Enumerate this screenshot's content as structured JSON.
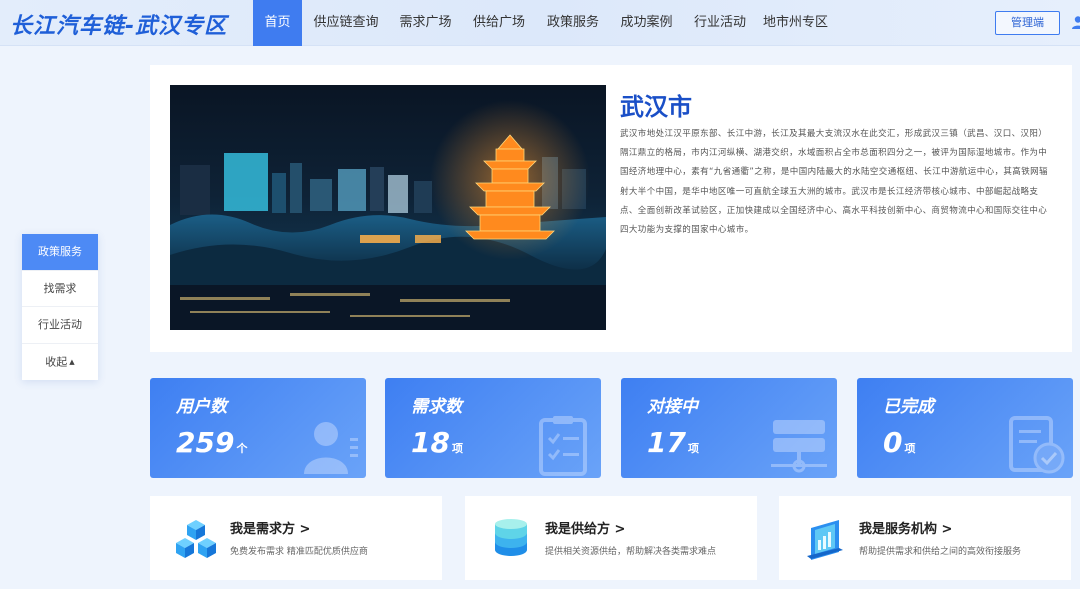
{
  "header": {
    "logo": "长江汽车链-武汉专区",
    "nav": [
      "首页",
      "供应链查询",
      "需求广场",
      "供给广场",
      "政策服务",
      "成功案例",
      "行业活动",
      "地市州专区"
    ],
    "admin_button": "管理端"
  },
  "side_menu": {
    "items": [
      "政策服务",
      "找需求",
      "行业活动",
      "收起"
    ]
  },
  "intro": {
    "city_title": "武汉市",
    "description": "武汉市地处江汉平原东部、长江中游，长江及其最大支流汉水在此交汇，形成武汉三镇（武昌、汉口、汉阳）隔江鼎立的格局，市内江河纵横、湖港交织，水域面积占全市总面积四分之一，被评为国际湿地城市。作为中国经济地理中心，素有“九省通衢”之称，是中国内陆最大的水陆空交通枢纽、长江中游航运中心，其高铁网辐射大半个中国，是华中地区唯一可直航全球五大洲的城市。武汉市是长江经济带核心城市、中部崛起战略支点、全面创新改革试验区，正加快建成以全国经济中心、高水平科技创新中心、商贸物流中心和国际交往中心四大功能为支撑的国家中心城市。"
  },
  "stats": [
    {
      "label": "用户数",
      "value": "259",
      "unit": "个",
      "icon": "user-icon"
    },
    {
      "label": "需求数",
      "value": "18",
      "unit": "项",
      "icon": "clipboard-checklist-icon"
    },
    {
      "label": "对接中",
      "value": "17",
      "unit": "项",
      "icon": "server-network-icon"
    },
    {
      "label": "已完成",
      "value": "0",
      "unit": "项",
      "icon": "document-check-icon"
    }
  ],
  "roles": [
    {
      "title": "我是需求方 >",
      "subtitle": "免费发布需求 精准匹配优质供应商",
      "icon": "cubes-icon"
    },
    {
      "title": "我是供给方 >",
      "subtitle": "提供相关资源供给，帮助解决各类需求难点",
      "icon": "database-stack-icon"
    },
    {
      "title": "我是服务机构 >",
      "subtitle": "帮助提供需求和供给之间的高效衔接服务",
      "icon": "building-chart-icon"
    }
  ],
  "colors": {
    "primary": "#3f7cf0",
    "title_blue": "#1a4fc7",
    "page_bg": "#eef4fd"
  }
}
